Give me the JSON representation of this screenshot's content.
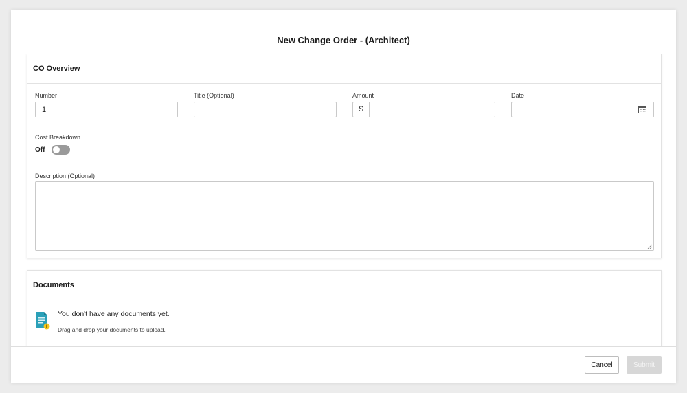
{
  "modal": {
    "title": "New Change Order - (Architect)"
  },
  "overview": {
    "header": "CO Overview",
    "number": {
      "label": "Number",
      "value": "1"
    },
    "title": {
      "label": "Title (Optional)",
      "value": ""
    },
    "amount": {
      "label": "Amount",
      "prefix": "$",
      "value": ""
    },
    "date": {
      "label": "Date",
      "value": "",
      "icon": "calendar-icon"
    },
    "cost_breakdown": {
      "label": "Cost Breakdown",
      "state_text": "Off",
      "enabled": false
    },
    "description": {
      "label": "Description (Optional)",
      "value": ""
    }
  },
  "documents": {
    "header": "Documents",
    "empty_icon": "document-upload-icon",
    "empty_title": "You don't have any documents yet.",
    "empty_subtitle": "Drag and drop your documents to upload."
  },
  "footer": {
    "cancel_label": "Cancel",
    "submit_label": "Submit",
    "submit_disabled": true
  },
  "colors": {
    "toggle_off": "#9a9a9a",
    "doc_icon_teal": "#2aa0b8",
    "doc_badge_yellow": "#f5c518",
    "submit_disabled_bg": "#d7d7d7"
  }
}
